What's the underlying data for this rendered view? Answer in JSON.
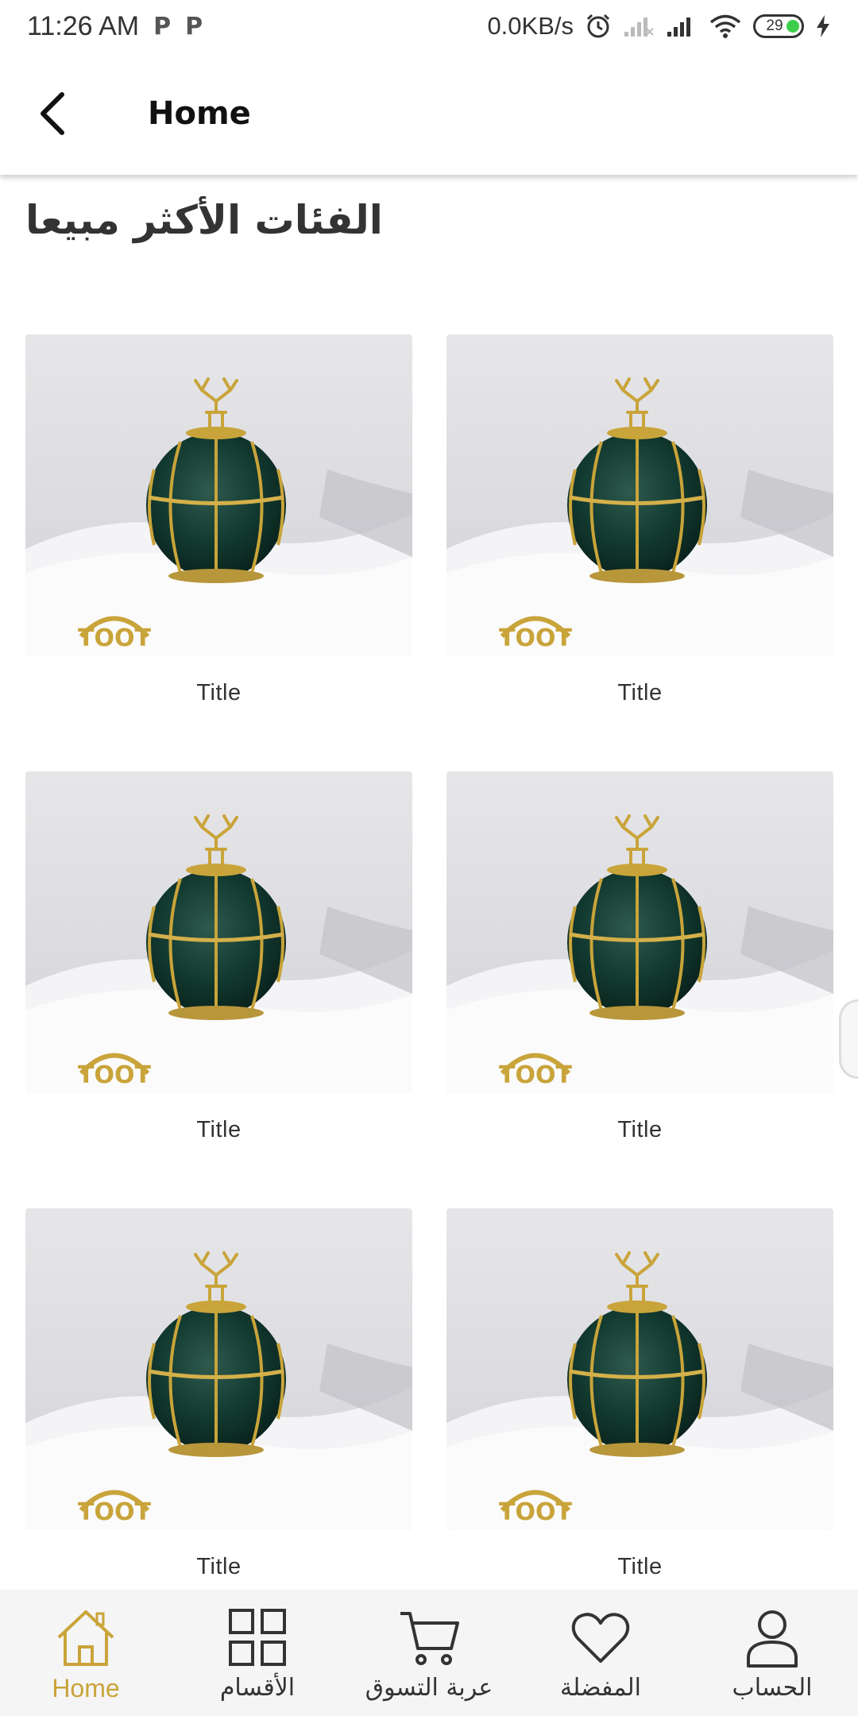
{
  "status_bar": {
    "time": "11:26 AM",
    "notif_1": "P",
    "notif_2": "P",
    "net_speed": "0.0KB/s",
    "battery": "29"
  },
  "app_bar": {
    "title": "Home"
  },
  "section": {
    "title": "الفئات الأكثر مبيعا"
  },
  "products": [
    {
      "title": "Title",
      "logo": "TOOT"
    },
    {
      "title": "Title",
      "logo": "TOOT"
    },
    {
      "title": "Title",
      "logo": "TOOT"
    },
    {
      "title": "Title",
      "logo": "TOOT"
    },
    {
      "title": "Title",
      "logo": "TOOT"
    },
    {
      "title": "Title",
      "logo": "TOOT"
    }
  ],
  "bottom_nav": {
    "items": [
      {
        "label": "Home",
        "icon": "home-icon",
        "active": true
      },
      {
        "label": "الأقسام",
        "icon": "grid-icon",
        "active": false
      },
      {
        "label": "عربة التسوق",
        "icon": "cart-icon",
        "active": false
      },
      {
        "label": "المفضلة",
        "icon": "heart-icon",
        "active": false
      },
      {
        "label": "الحساب",
        "icon": "user-icon",
        "active": false
      }
    ]
  },
  "colors": {
    "accent": "#c9a43a",
    "nav_bg": "#f5f5f5",
    "text": "#333333"
  }
}
